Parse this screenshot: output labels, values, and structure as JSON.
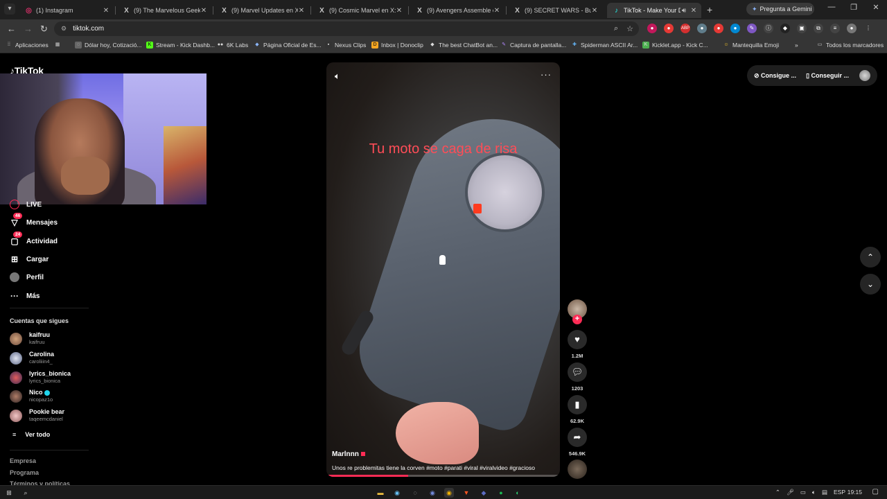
{
  "browser": {
    "tabs": [
      {
        "title": "(1) Instagram",
        "icon": "instagram-icon",
        "active": false
      },
      {
        "title": "(9) The Marvelous Geek en X",
        "icon": "x-icon",
        "active": false
      },
      {
        "title": "(9) Marvel Updates en X: \"",
        "icon": "x-icon",
        "active": false
      },
      {
        "title": "(9) Cosmic Marvel en X: \"/",
        "icon": "x-icon",
        "active": false
      },
      {
        "title": "(9) Avengers Assemble en X",
        "icon": "x-icon",
        "active": false
      },
      {
        "title": "(9) SECRET WARS - Buscar",
        "icon": "x-icon",
        "active": false
      },
      {
        "title": "TikTok - Make Your Day",
        "icon": "tiktok-icon",
        "active": true
      }
    ],
    "gemini_label": "Pregunta a Gemini",
    "url": "tiktok.com",
    "bookmarks": [
      "Aplicaciones",
      "Dólar hoy, Cotizació...",
      "Stream - Kick Dashb...",
      "6K Labs",
      "Página Oficial de Es...",
      "Nexus Clips",
      "Inbox | Donoclip",
      "The best ChatBot an...",
      "Captura de pantalla...",
      "Spiderman ASCII Ar...",
      "Kicklet.app - Kick C...",
      "Mantequilla Emoji"
    ],
    "all_bookmarks_label": "Todos los marcadores"
  },
  "tiktok": {
    "logo": "TikTok",
    "nav": [
      {
        "label": "LIVE",
        "icon": "live-icon",
        "badge": ""
      },
      {
        "label": "Mensajes",
        "icon": "messages-icon",
        "badge": "46"
      },
      {
        "label": "Actividad",
        "icon": "activity-icon",
        "badge": "24"
      },
      {
        "label": "Cargar",
        "icon": "upload-icon",
        "badge": ""
      },
      {
        "label": "Perfil",
        "icon": "profile-icon",
        "badge": ""
      },
      {
        "label": "Más",
        "icon": "more-icon",
        "badge": ""
      }
    ],
    "following_title": "Cuentas que sigues",
    "following": [
      {
        "name": "kaifruu",
        "user": "kaifruu",
        "verified": false
      },
      {
        "name": "Carolina",
        "user": "caroliiin4_",
        "verified": false
      },
      {
        "name": "lyrics_bionica",
        "user": "lyrics_bionica",
        "verified": false
      },
      {
        "name": "Nico",
        "user": "nicopaz1o",
        "verified": true
      },
      {
        "name": "Pookie bear",
        "user": "taqeemcdaniel",
        "verified": false
      }
    ],
    "see_all": "Ver todo",
    "footer": [
      "Empresa",
      "Programa",
      "Términos y políticas"
    ],
    "top_right": {
      "get_coins": "Consigue ...",
      "get_app": "Conseguir ..."
    },
    "video": {
      "overlay_text": "Tu moto se caga de risa",
      "author": "Marlnnn",
      "description": "Unos re problemitas tiene la corven #moto #parati #viral #viralvideo #gracioso",
      "progress": 0.35
    },
    "actions": {
      "likes": "1.2M",
      "comments": "1203",
      "saves": "62.9K",
      "shares": "546.9K"
    }
  },
  "taskbar": {
    "language": "ESP",
    "time": "19:15"
  }
}
